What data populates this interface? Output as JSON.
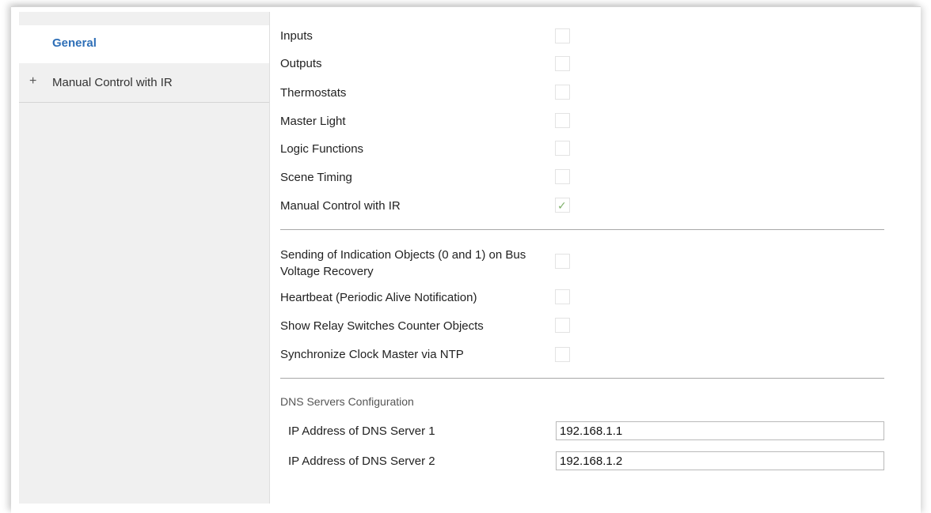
{
  "sidebar": {
    "items": [
      {
        "label": "General",
        "active": true
      },
      {
        "label": "Manual Control with IR",
        "expander_icon": "plus-icon"
      }
    ]
  },
  "functions": [
    {
      "label": "Inputs",
      "checked": false
    },
    {
      "label": "Outputs",
      "checked": false
    },
    {
      "label": "Thermostats",
      "checked": false
    },
    {
      "label": "Master Light",
      "checked": false
    },
    {
      "label": "Logic Functions",
      "checked": false
    },
    {
      "label": "Scene Timing",
      "checked": false
    },
    {
      "label": "Manual Control with IR",
      "checked": true
    }
  ],
  "options": [
    {
      "label": "Sending of Indication Objects (0 and 1) on Bus Voltage Recovery",
      "checked": false
    },
    {
      "label": "Heartbeat (Periodic Alive Notification)",
      "checked": false
    },
    {
      "label": "Show Relay Switches Counter Objects",
      "checked": false
    },
    {
      "label": "Synchronize Clock Master via NTP",
      "checked": false
    }
  ],
  "dns": {
    "title": "DNS Servers Configuration",
    "server1_label": "IP Address of DNS Server 1",
    "server1_value": "192.168.1.1",
    "server2_label": "IP Address of DNS Server 2",
    "server2_value": "192.168.1.2"
  },
  "colors": {
    "accent": "#2e6fb7",
    "check": "#7fb06a"
  }
}
